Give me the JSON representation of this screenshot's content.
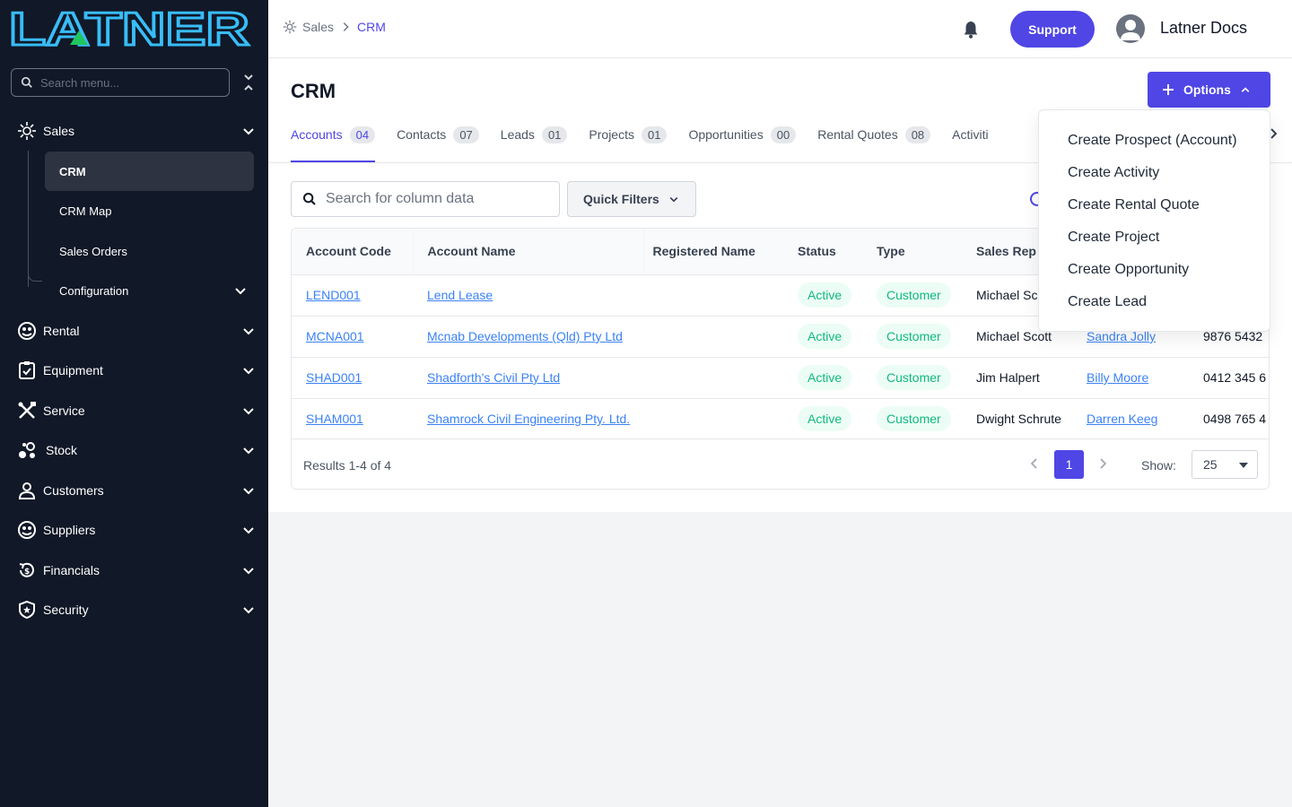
{
  "colors": {
    "accent": "#4f46e5",
    "sidebar_bg": "#111827",
    "status_green": "#10b981",
    "link": "#3b82f6"
  },
  "sidebar": {
    "logo_text": "LATNER",
    "search_placeholder": "Search menu...",
    "items": [
      {
        "label": "Sales",
        "icon": "sales-icon",
        "expanded": true
      },
      {
        "label": "Rental",
        "icon": "rental-icon"
      },
      {
        "label": "Equipment",
        "icon": "clipboard-icon"
      },
      {
        "label": "Service",
        "icon": "tools-icon"
      },
      {
        "label": "Stock",
        "icon": "stock-icon"
      },
      {
        "label": "Customers",
        "icon": "user-icon"
      },
      {
        "label": "Suppliers",
        "icon": "suppliers-icon"
      },
      {
        "label": "Financials",
        "icon": "dollar-icon"
      },
      {
        "label": "Security",
        "icon": "shield-icon"
      }
    ],
    "sales_sub": [
      {
        "label": "CRM",
        "active": true
      },
      {
        "label": "CRM Map"
      },
      {
        "label": "Sales Orders"
      },
      {
        "label": "Configuration"
      }
    ]
  },
  "topbar": {
    "breadcrumb_root": "Sales",
    "breadcrumb_current": "CRM",
    "support_label": "Support",
    "user_name": "Latner Docs"
  },
  "main": {
    "title": "CRM",
    "options_label": "Options",
    "tabs": [
      {
        "label": "Accounts",
        "count": "04",
        "active": true
      },
      {
        "label": "Contacts",
        "count": "07"
      },
      {
        "label": "Leads",
        "count": "01"
      },
      {
        "label": "Projects",
        "count": "01"
      },
      {
        "label": "Opportunities",
        "count": "00"
      },
      {
        "label": "Rental Quotes",
        "count": "08"
      },
      {
        "label": "Activiti"
      }
    ],
    "search_placeholder": "Search for column data",
    "quick_filters_label": "Quick Filters",
    "table": {
      "headers": [
        "Account Code",
        "Account Name",
        "Registered Name",
        "Status",
        "Type",
        "Sales Rep",
        "",
        ""
      ],
      "rows": [
        {
          "code": "LEND001",
          "name": "Lend Lease",
          "registered": "",
          "status": "Active",
          "type": "Customer",
          "rep": "Michael Sc",
          "contact": "",
          "phone": ""
        },
        {
          "code": "MCNA001",
          "name": "Mcnab Developments (Qld) Pty Ltd",
          "registered": "",
          "status": "Active",
          "type": "Customer",
          "rep": "Michael Scott",
          "contact": "Sandra Jolly",
          "phone": "9876 5432"
        },
        {
          "code": "SHAD001",
          "name": "Shadforth's Civil Pty Ltd",
          "registered": "",
          "status": "Active",
          "type": "Customer",
          "rep": "Jim Halpert",
          "contact": "Billy Moore",
          "phone": "0412 345 6"
        },
        {
          "code": "SHAM001",
          "name": "Shamrock Civil Engineering Pty. Ltd.",
          "registered": "",
          "status": "Active",
          "type": "Customer",
          "rep": "Dwight Schrute",
          "contact": "Darren Keeg",
          "phone": "0498 765 4"
        }
      ]
    },
    "footer": {
      "results": "Results 1-4 of 4",
      "current_page": "1",
      "show_label": "Show:",
      "page_size": "25"
    }
  },
  "options_menu": [
    "Create Prospect (Account)",
    "Create Activity",
    "Create Rental Quote",
    "Create Project",
    "Create Opportunity",
    "Create Lead"
  ]
}
